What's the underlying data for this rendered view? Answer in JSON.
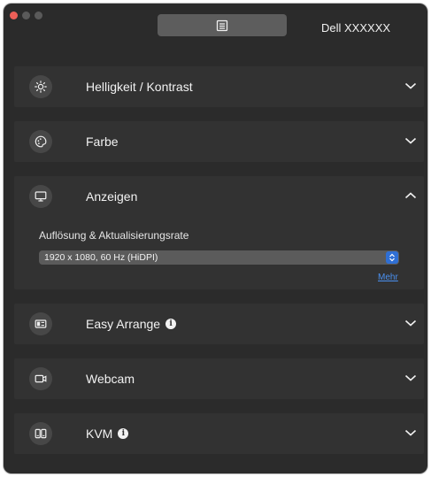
{
  "window": {
    "tab_icon": "document-icon",
    "monitor_name": "Dell XXXXXX"
  },
  "sections": [
    {
      "label": "Helligkeit / Kontrast",
      "icon": "brightness-icon",
      "expanded": false,
      "info": false
    },
    {
      "label": "Farbe",
      "icon": "palette-icon",
      "expanded": false,
      "info": false
    },
    {
      "label": "Anzeigen",
      "icon": "display-icon",
      "expanded": true,
      "info": false
    },
    {
      "label": "Easy Arrange",
      "icon": "layout-icon",
      "expanded": false,
      "info": true
    },
    {
      "label": "Webcam",
      "icon": "webcam-icon",
      "expanded": false,
      "info": false
    },
    {
      "label": "KVM",
      "icon": "kvm-icon",
      "expanded": false,
      "info": true
    }
  ],
  "display": {
    "resolution_label": "Auflösung & Aktualisierungsrate",
    "resolution_value": "1920 x 1080, 60 Hz (HiDPI)",
    "more_link": "Mehr"
  },
  "info_glyph": "i",
  "colors": {
    "background": "#2b2b2b",
    "panel": "#323232",
    "accent": "#2f6fd4",
    "link": "#4a90f0",
    "close": "#ec5f58"
  }
}
